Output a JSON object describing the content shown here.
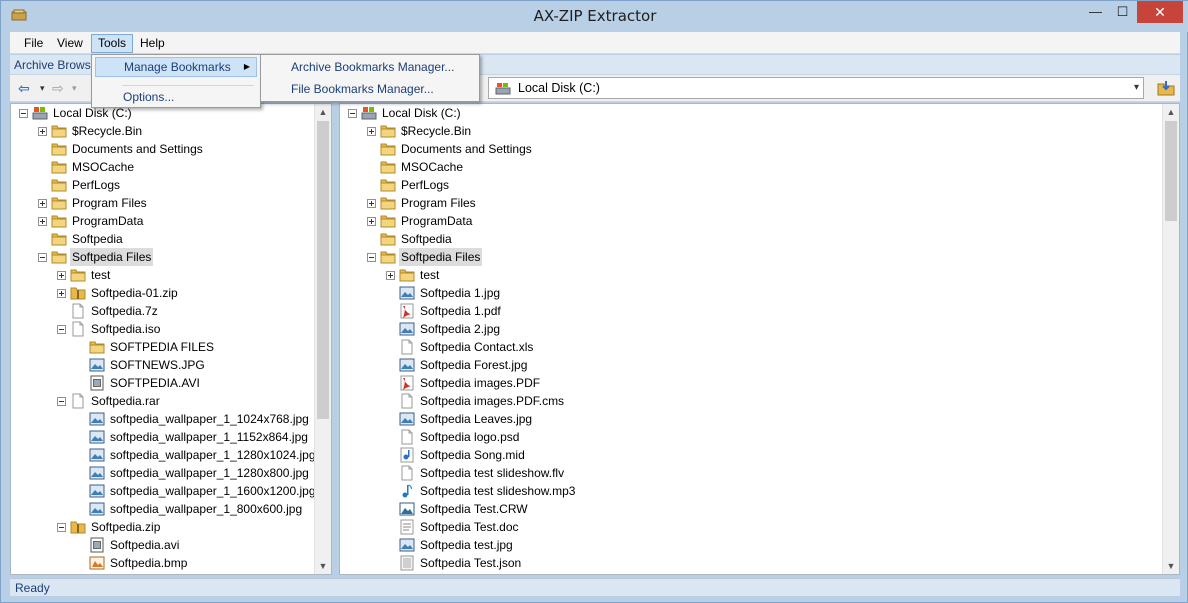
{
  "window": {
    "title": "AX-ZIP Extractor",
    "min": "—",
    "max": "☐",
    "close": "✕"
  },
  "menubar": {
    "file": "File",
    "view": "View",
    "tools": "Tools",
    "help": "Help"
  },
  "subheader": {
    "tab_label": "Archive Browse"
  },
  "tools_menu": {
    "items": [
      {
        "label": "Manage Bookmarks",
        "has_submenu": true
      },
      {
        "label": "Options..."
      }
    ]
  },
  "bookmarks_submenu": {
    "items": [
      {
        "label": "Archive Bookmarks Manager..."
      },
      {
        "label": "File Bookmarks Manager..."
      }
    ]
  },
  "toolbar": {
    "back": "⇦",
    "forward": "⇨",
    "dropdown_arrow": "▾",
    "drive_label": "Local Disk (C:)",
    "combo_arrow": "▾"
  },
  "left_tree": [
    {
      "label": "Local Disk (C:)",
      "icon": "drive-icon",
      "level": 0,
      "expander": "minus"
    },
    {
      "label": "$Recycle.Bin",
      "icon": "folder-icon",
      "level": 1,
      "expander": "plus"
    },
    {
      "label": "Documents and Settings",
      "icon": "folder-icon",
      "level": 1,
      "expander": "none"
    },
    {
      "label": "MSOCache",
      "icon": "folder-icon",
      "level": 1,
      "expander": "none"
    },
    {
      "label": "PerfLogs",
      "icon": "folder-icon",
      "level": 1,
      "expander": "none"
    },
    {
      "label": "Program Files",
      "icon": "folder-icon",
      "level": 1,
      "expander": "plus"
    },
    {
      "label": "ProgramData",
      "icon": "folder-icon",
      "level": 1,
      "expander": "plus"
    },
    {
      "label": "Softpedia",
      "icon": "folder-icon",
      "level": 1,
      "expander": "none"
    },
    {
      "label": "Softpedia Files",
      "icon": "folder-icon",
      "level": 1,
      "expander": "minus",
      "selected": true
    },
    {
      "label": "test",
      "icon": "folder-icon",
      "level": 2,
      "expander": "plus"
    },
    {
      "label": "Softpedia-01.zip",
      "icon": "zip-icon",
      "level": 2,
      "expander": "plus"
    },
    {
      "label": "Softpedia.7z",
      "icon": "file-icon",
      "level": 2,
      "expander": "none"
    },
    {
      "label": "Softpedia.iso",
      "icon": "file-icon",
      "level": 2,
      "expander": "minus"
    },
    {
      "label": "SOFTPEDIA FILES",
      "icon": "folder-icon",
      "level": 3,
      "expander": "none"
    },
    {
      "label": "SOFTNEWS.JPG",
      "icon": "image-icon",
      "level": 3,
      "expander": "none"
    },
    {
      "label": "SOFTPEDIA.AVI",
      "icon": "video-icon",
      "level": 3,
      "expander": "none"
    },
    {
      "label": "Softpedia.rar",
      "icon": "file-icon",
      "level": 2,
      "expander": "minus"
    },
    {
      "label": "softpedia_wallpaper_1_1024x768.jpg",
      "icon": "image-icon",
      "level": 3,
      "expander": "none"
    },
    {
      "label": "softpedia_wallpaper_1_1152x864.jpg",
      "icon": "image-icon",
      "level": 3,
      "expander": "none"
    },
    {
      "label": "softpedia_wallpaper_1_1280x1024.jpg",
      "icon": "image-icon",
      "level": 3,
      "expander": "none"
    },
    {
      "label": "softpedia_wallpaper_1_1280x800.jpg",
      "icon": "image-icon",
      "level": 3,
      "expander": "none"
    },
    {
      "label": "softpedia_wallpaper_1_1600x1200.jpg",
      "icon": "image-icon",
      "level": 3,
      "expander": "none"
    },
    {
      "label": "softpedia_wallpaper_1_800x600.jpg",
      "icon": "image-icon",
      "level": 3,
      "expander": "none"
    },
    {
      "label": "Softpedia.zip",
      "icon": "zip-icon",
      "level": 2,
      "expander": "minus"
    },
    {
      "label": "Softpedia.avi",
      "icon": "video-icon",
      "level": 3,
      "expander": "none"
    },
    {
      "label": "Softpedia.bmp",
      "icon": "bmp-icon",
      "level": 3,
      "expander": "none"
    }
  ],
  "right_tree": [
    {
      "label": "Local Disk (C:)",
      "icon": "drive-icon",
      "level": 0,
      "expander": "minus"
    },
    {
      "label": "$Recycle.Bin",
      "icon": "folder-icon",
      "level": 1,
      "expander": "plus"
    },
    {
      "label": "Documents and Settings",
      "icon": "folder-icon",
      "level": 1,
      "expander": "none"
    },
    {
      "label": "MSOCache",
      "icon": "folder-icon",
      "level": 1,
      "expander": "none"
    },
    {
      "label": "PerfLogs",
      "icon": "folder-icon",
      "level": 1,
      "expander": "none"
    },
    {
      "label": "Program Files",
      "icon": "folder-icon",
      "level": 1,
      "expander": "plus"
    },
    {
      "label": "ProgramData",
      "icon": "folder-icon",
      "level": 1,
      "expander": "plus"
    },
    {
      "label": "Softpedia",
      "icon": "folder-icon",
      "level": 1,
      "expander": "none"
    },
    {
      "label": "Softpedia Files",
      "icon": "folder-icon",
      "level": 1,
      "expander": "minus",
      "selected": true
    },
    {
      "label": "test",
      "icon": "folder-icon",
      "level": 2,
      "expander": "plus"
    },
    {
      "label": "Softpedia 1.jpg",
      "icon": "image-icon",
      "level": 2,
      "expander": "none"
    },
    {
      "label": "Softpedia 1.pdf",
      "icon": "pdf-icon",
      "level": 2,
      "expander": "none"
    },
    {
      "label": "Softpedia 2.jpg",
      "icon": "image-icon",
      "level": 2,
      "expander": "none"
    },
    {
      "label": "Softpedia Contact.xls",
      "icon": "file-icon",
      "level": 2,
      "expander": "none"
    },
    {
      "label": "Softpedia Forest.jpg",
      "icon": "image-icon",
      "level": 2,
      "expander": "none"
    },
    {
      "label": "Softpedia images.PDF",
      "icon": "pdf-icon",
      "level": 2,
      "expander": "none"
    },
    {
      "label": "Softpedia images.PDF.cms",
      "icon": "file-icon",
      "level": 2,
      "expander": "none"
    },
    {
      "label": "Softpedia Leaves.jpg",
      "icon": "image-icon",
      "level": 2,
      "expander": "none"
    },
    {
      "label": "Softpedia logo.psd",
      "icon": "file-icon",
      "level": 2,
      "expander": "none"
    },
    {
      "label": "Softpedia Song.mid",
      "icon": "midi-icon",
      "level": 2,
      "expander": "none"
    },
    {
      "label": "Softpedia test slideshow.flv",
      "icon": "file-icon",
      "level": 2,
      "expander": "none"
    },
    {
      "label": "Softpedia test slideshow.mp3",
      "icon": "music-icon",
      "level": 2,
      "expander": "none"
    },
    {
      "label": "Softpedia Test.CRW",
      "icon": "photo-icon",
      "level": 2,
      "expander": "none"
    },
    {
      "label": "Softpedia Test.doc",
      "icon": "doc-icon",
      "level": 2,
      "expander": "none"
    },
    {
      "label": "Softpedia test.jpg",
      "icon": "image-icon",
      "level": 2,
      "expander": "none"
    },
    {
      "label": "Softpedia Test.json",
      "icon": "text-icon",
      "level": 2,
      "expander": "none"
    }
  ],
  "scroll": {
    "up": "▲",
    "down": "▼"
  },
  "status": {
    "text": "Ready"
  },
  "colors": {
    "folder": "#e8b84a",
    "accent": "#1c3f77",
    "close": "#c7443a"
  }
}
